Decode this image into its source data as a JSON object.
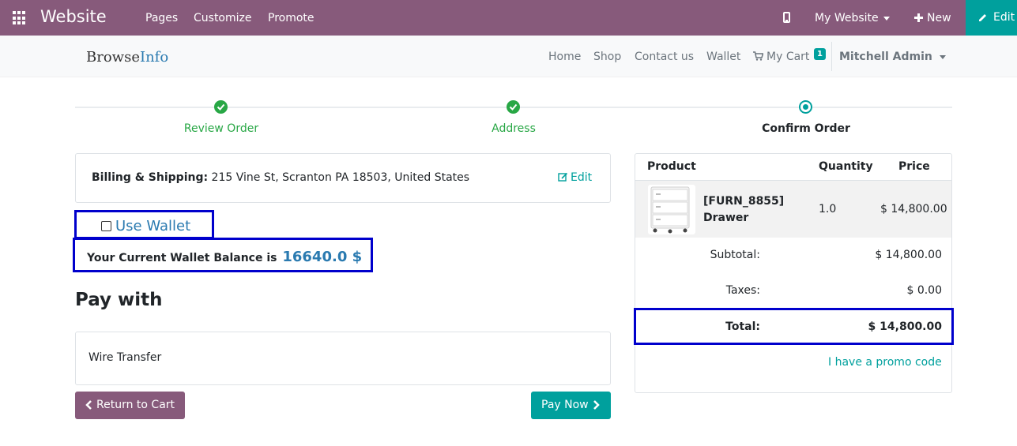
{
  "topbar": {
    "brand": "Website",
    "menu": [
      "Pages",
      "Customize",
      "Promote"
    ],
    "website_selector": "My Website",
    "new_label": "New",
    "edit_label": "Edit",
    "bg_color": "#875a7b",
    "edit_color": "#00a09d"
  },
  "sitenav": {
    "logo_part1": "Browse",
    "logo_part2": "Info",
    "links": [
      "Home",
      "Shop",
      "Contact us",
      "Wallet"
    ],
    "cart_label": "My Cart",
    "cart_count": "1",
    "user": "Mitchell Admin"
  },
  "wizard": {
    "steps": [
      {
        "label": "Review Order",
        "state": "done"
      },
      {
        "label": "Address",
        "state": "done"
      },
      {
        "label": "Confirm Order",
        "state": "current"
      }
    ]
  },
  "billing": {
    "label": "Billing & Shipping:",
    "address": "215 Vine St, Scranton PA 18503, United States",
    "edit_label": "Edit"
  },
  "wallet": {
    "use_label": "Use Wallet",
    "checked": false,
    "balance_label": "Your Current Wallet Balance is",
    "balance_value": "16640.0 $"
  },
  "payment": {
    "heading": "Pay with",
    "method": "Wire Transfer",
    "return_label": "Return to Cart",
    "pay_label": "Pay Now"
  },
  "summary": {
    "headers": {
      "product": "Product",
      "quantity": "Quantity",
      "price": "Price"
    },
    "line": {
      "name": "[FURN_8855] Drawer",
      "qty": "1.0",
      "price": "$ 14,800.00"
    },
    "subtotal_label": "Subtotal:",
    "subtotal": "$ 14,800.00",
    "taxes_label": "Taxes:",
    "taxes": "$ 0.00",
    "total_label": "Total:",
    "total": "$ 14,800.00",
    "promo_label": "I have a promo code"
  }
}
